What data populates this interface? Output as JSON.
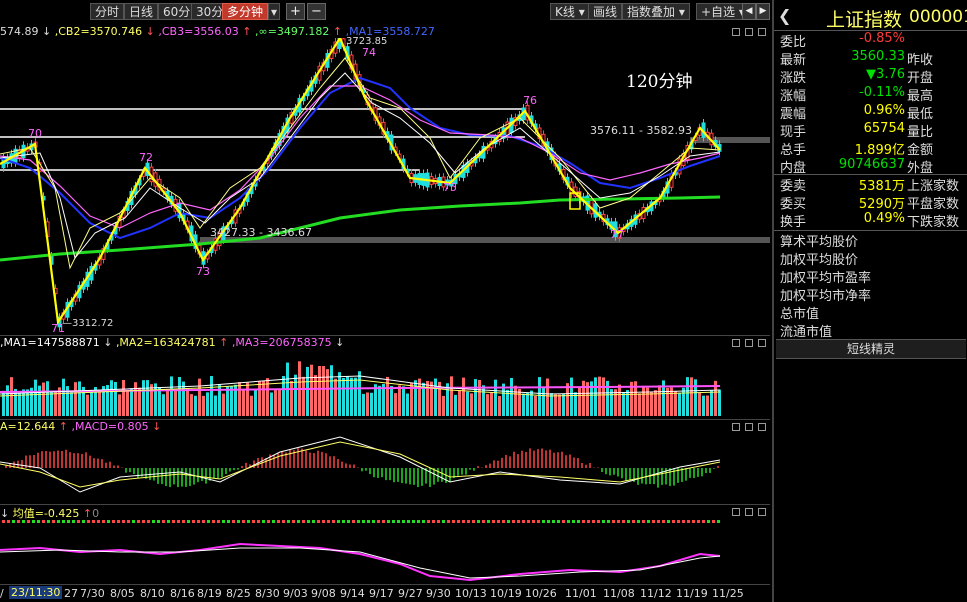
{
  "toolbar": {
    "periods": [
      "分时",
      "日线",
      "60分",
      "30分",
      "多分钟"
    ],
    "active_period": "多分钟",
    "plus": "+",
    "minus": "−",
    "line_type": "K线",
    "draw": "画线",
    "overlay": "指数叠加",
    "watch": "+自选",
    "prev": "◀",
    "next": "▶"
  },
  "main_chart": {
    "ind_first": "574.89",
    "ind_cb2": ",CB2=3570.746",
    "ind_cb3": ",CB3=3556.03",
    "ind_inf": ",∞=3497.182",
    "ind_ma1": ",MA1=3558.727",
    "period_label": "120分钟",
    "annotations": {
      "hi": "3723.85",
      "lo": "3312.72",
      "mid": "3427.33 - 3436.67",
      "right": "3576.11 - 3582.93"
    },
    "wave_labels": [
      "70",
      "71",
      "72",
      "73",
      "74",
      "75",
      "76",
      "77"
    ]
  },
  "volume_panel": {
    "ma1": ",MA1=147588871",
    "ma2": ",MA2=163424781",
    "ma3": ",MA3=206758375"
  },
  "macd_panel": {
    "a": "A=12.644",
    "macd": ",MACD=0.805"
  },
  "avg_panel": {
    "avg": "均值=-0.425",
    "zero": "0"
  },
  "x_axis": {
    "first_label": "23/11:30",
    "labels": [
      "7/30",
      "8/05",
      "8/10",
      "8/16",
      "8/19",
      "8/25",
      "8/30",
      "9/03",
      "9/08",
      "9/14",
      "9/17",
      "9/27",
      "9/30",
      "10/13",
      "10/19",
      "10/26",
      "11/01",
      "11/08",
      "11/12",
      "11/19",
      "11/25"
    ],
    "left_cut": "/",
    "left_27": "27"
  },
  "quote": {
    "title": "上证指数",
    "code": "000001",
    "back": "❮",
    "rows": [
      {
        "l": "委比",
        "v": "-0.85%",
        "c": "red",
        "r": ""
      },
      {
        "l": "最新",
        "v": "3560.33",
        "c": "green",
        "r": "昨收"
      },
      {
        "l": "涨跌",
        "v": "▼3.76",
        "c": "green",
        "r": "开盘"
      },
      {
        "l": "涨幅",
        "v": "-0.11%",
        "c": "green",
        "r": "最高"
      },
      {
        "l": "震幅",
        "v": "0.96%",
        "c": "yellow",
        "r": "最低"
      },
      {
        "l": "现手",
        "v": "65754",
        "c": "yellow",
        "r": "量比"
      },
      {
        "l": "总手",
        "v": "1.899亿",
        "c": "yellow",
        "r": "金额"
      },
      {
        "l": "内盘",
        "v": "90746637",
        "c": "green",
        "r": "外盘"
      }
    ],
    "rows2": [
      {
        "l": "委卖",
        "v": "5381万",
        "c": "yellow",
        "r": "上涨家数"
      },
      {
        "l": "委买",
        "v": "5290万",
        "c": "yellow",
        "r": "平盘家数"
      },
      {
        "l": "换手",
        "v": "0.49%",
        "c": "yellow",
        "r": "下跌家数"
      }
    ],
    "fin": [
      "算术平均股价",
      "加权平均股价",
      "加权平均市盈率",
      "加权平均市净率",
      "总市值",
      "流通市值"
    ],
    "sprite": "短线精灵"
  }
}
